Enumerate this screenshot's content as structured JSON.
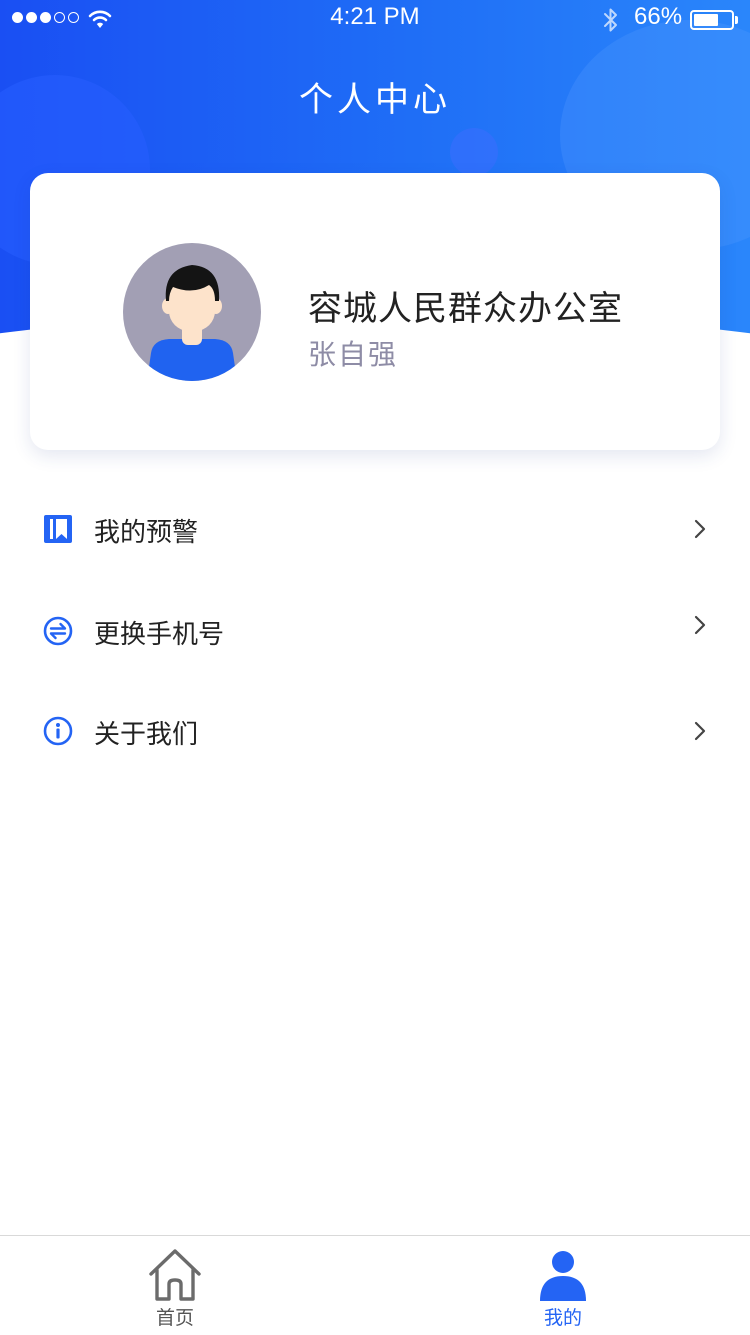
{
  "colors": {
    "primary": "#2464f4",
    "header_gradient_start": "#1a4ff3",
    "header_gradient_end": "#2a86fb",
    "subtitle_gray": "#8e8ca6",
    "tab_inactive": "#555555"
  },
  "status_bar": {
    "signal_bars_filled": 3,
    "signal_bars_total": 5,
    "time": "4:21 PM",
    "battery_percent": "66%",
    "battery_level": 0.66,
    "icons": [
      "wifi-icon",
      "bluetooth-icon",
      "battery-icon"
    ]
  },
  "header": {
    "title": "个人中心"
  },
  "profile": {
    "organization": "容城人民群众办公室",
    "name": "张自强",
    "avatar_icon": "user-avatar"
  },
  "menu": {
    "items": [
      {
        "label": "我的预警",
        "icon": "bookmark-icon"
      },
      {
        "label": "更换手机号",
        "icon": "swap-icon"
      },
      {
        "label": "关于我们",
        "icon": "info-icon"
      }
    ]
  },
  "tab_bar": {
    "tabs": [
      {
        "label": "首页",
        "icon": "home-icon",
        "active": false
      },
      {
        "label": "我的",
        "icon": "user-icon",
        "active": true
      }
    ]
  }
}
